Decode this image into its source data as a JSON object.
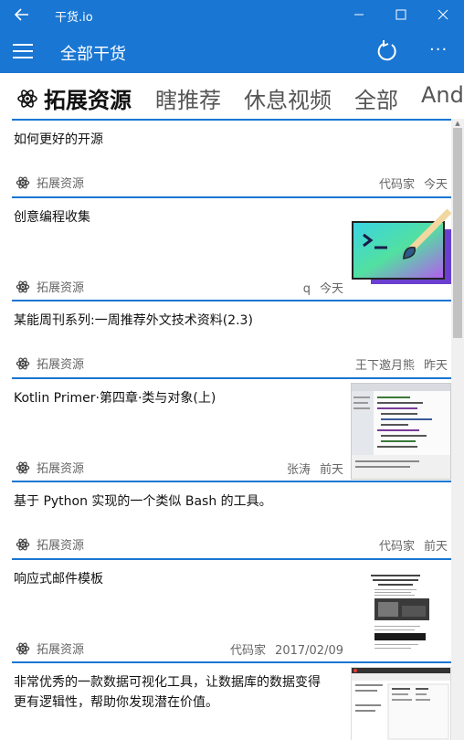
{
  "window": {
    "title": "干货.io"
  },
  "appbar": {
    "title": "全部干货"
  },
  "tabs": [
    {
      "label": "拓展资源",
      "active": true
    },
    {
      "label": "瞎推荐"
    },
    {
      "label": "休息视频"
    },
    {
      "label": "全部"
    },
    {
      "label": "Andr"
    }
  ],
  "items": [
    {
      "title": "如何更好的开源",
      "category": "拓展资源",
      "author": "代码家",
      "time": "今天",
      "thumb": ""
    },
    {
      "title": "创意编程收集",
      "category": "拓展资源",
      "author": "q",
      "time": "今天",
      "thumb": "terminal-brush"
    },
    {
      "title": "某能周刊系列:一周推荐外文技术资料(2.3)",
      "category": "拓展资源",
      "author": "王下邀月熊",
      "time": "昨天",
      "thumb": ""
    },
    {
      "title": "Kotlin Primer·第四章·类与对象(上)",
      "category": "拓展资源",
      "author": "张涛",
      "time": "前天",
      "thumb": "ide-screenshot"
    },
    {
      "title": "基于 Python 实现的一个类似 Bash 的工具。",
      "category": "拓展资源",
      "author": "代码家",
      "time": "前天",
      "thumb": ""
    },
    {
      "title": "响应式邮件模板",
      "category": "拓展资源",
      "author": "代码家",
      "time": "2017/02/09",
      "thumb": "email-template"
    },
    {
      "title_line1": "非常优秀的一款数据可视化工具，让数据库的数据变得",
      "title_line2": "更有逻辑性，帮助你发现潜在价值。",
      "thumb": "spreadsheet"
    }
  ],
  "colors": {
    "accent": "#1976d2",
    "text": "#111111",
    "meta": "#666666"
  },
  "icons": {
    "back": "back-arrow-icon",
    "menu": "hamburger-icon",
    "refresh": "refresh-icon",
    "more": "more-icon",
    "category": "atom-icon"
  }
}
